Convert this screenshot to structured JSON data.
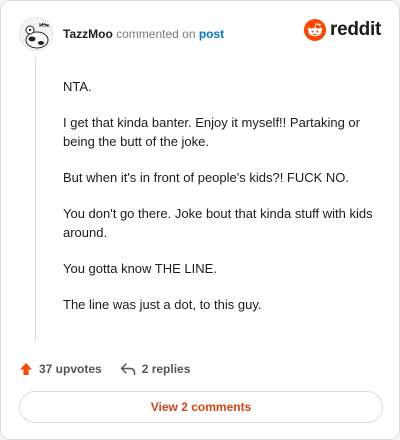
{
  "comment": {
    "username": "TazzMoo",
    "action_text": " commented on ",
    "post_link": "post",
    "paragraphs": [
      "NTA.",
      "I get that kinda banter. Enjoy it myself!! Partaking or being the butt of the joke.",
      "But when it's in front of people's kids?! FUCK NO.",
      "You don't go there. Joke bout that kinda stuff with kids around.",
      "You gotta know THE LINE.",
      "The line was just a dot, to this guy."
    ]
  },
  "brand": {
    "wordmark": "reddit",
    "color": "#ff4500"
  },
  "actions": {
    "upvotes_label": "37 upvotes",
    "replies_label": "2 replies",
    "upvote_color": "#ff4500"
  },
  "footer": {
    "view_comments_label": "View 2 comments"
  }
}
